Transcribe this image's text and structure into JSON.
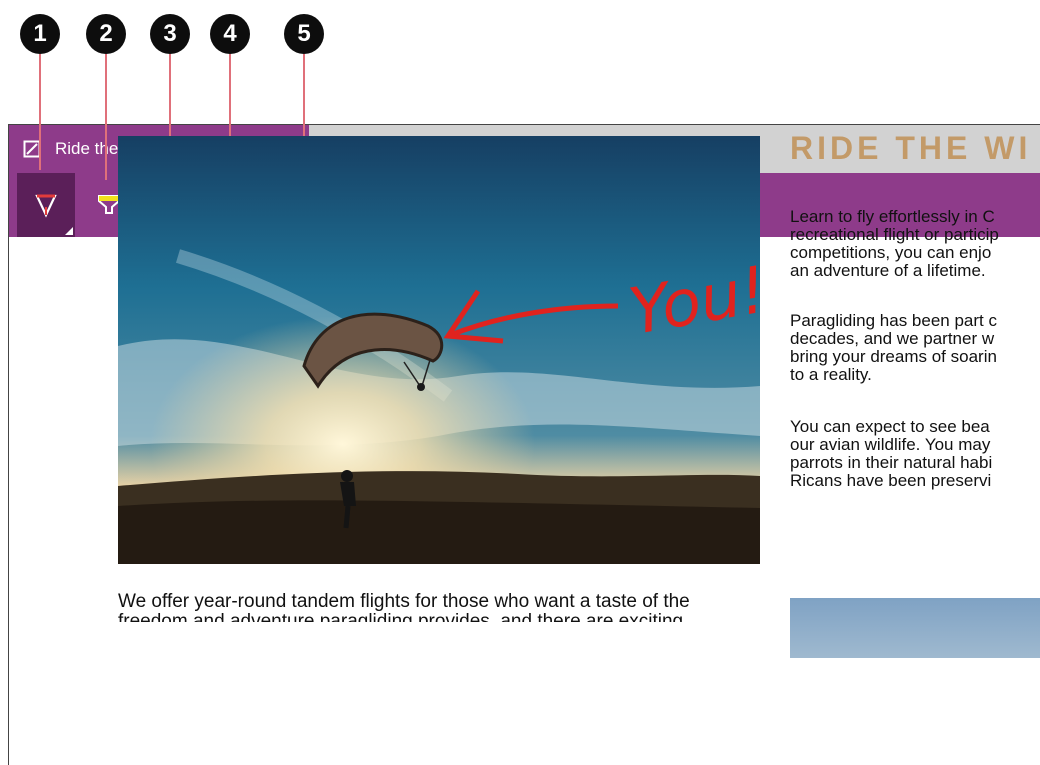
{
  "callouts": [
    "1",
    "2",
    "3",
    "4",
    "5"
  ],
  "browser": {
    "tab_title": "Ride the Wind | Resort",
    "close_symbol": "✕",
    "new_tab_symbol": "+"
  },
  "toolbar": {
    "tools": [
      "pen-icon",
      "highlighter-icon",
      "eraser-icon",
      "comment-icon",
      "clip-icon"
    ],
    "accent": "#8e3b8a",
    "selected_bg": "#5b1f59"
  },
  "hero": {
    "annotation": "You!"
  },
  "content": {
    "heading": "RIDE THE WI",
    "para1": "Learn to fly effortlessly in C\nrecreational flight or particip\ncompetitions, you can enjo\nan adventure of a lifetime.",
    "para2": "Paragliding has been part c\ndecades, and we partner w\nbring your dreams of soarin\nto a reality.",
    "para3": "You can expect to see bea\nour avian wildlife. You may\nparrots in their natural habi\nRicans have been preservi",
    "bottom": "We offer year-round tandem flights for those who want a taste of the freedom and adventure paragliding provides, and there are exciting"
  }
}
